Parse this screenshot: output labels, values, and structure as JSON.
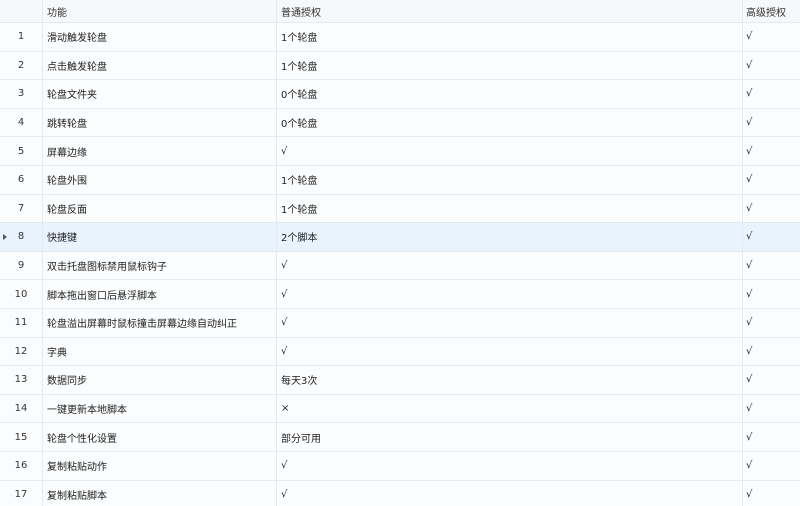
{
  "columns": [
    "功能",
    "普通授权",
    "高级授权"
  ],
  "selected_index": 7,
  "rows": [
    {
      "no": "1",
      "feature": "滑动触发轮盘",
      "normal": "1个轮盘",
      "advanced": "√"
    },
    {
      "no": "2",
      "feature": "点击触发轮盘",
      "normal": "1个轮盘",
      "advanced": "√"
    },
    {
      "no": "3",
      "feature": "轮盘文件夹",
      "normal": "0个轮盘",
      "advanced": "√"
    },
    {
      "no": "4",
      "feature": "跳转轮盘",
      "normal": "0个轮盘",
      "advanced": "√"
    },
    {
      "no": "5",
      "feature": "屏幕边缘",
      "normal": "√",
      "advanced": "√"
    },
    {
      "no": "6",
      "feature": "轮盘外围",
      "normal": "1个轮盘",
      "advanced": "√"
    },
    {
      "no": "7",
      "feature": "轮盘反面",
      "normal": "1个轮盘",
      "advanced": "√"
    },
    {
      "no": "8",
      "feature": "快捷键",
      "normal": "2个脚本",
      "advanced": "√"
    },
    {
      "no": "9",
      "feature": "双击托盘图标禁用鼠标钩子",
      "normal": "√",
      "advanced": "√"
    },
    {
      "no": "10",
      "feature": "脚本拖出窗口后悬浮脚本",
      "normal": "√",
      "advanced": "√"
    },
    {
      "no": "11",
      "feature": "轮盘溢出屏幕时鼠标撞击屏幕边缘自动纠正",
      "normal": "√",
      "advanced": "√"
    },
    {
      "no": "12",
      "feature": "字典",
      "normal": "√",
      "advanced": "√"
    },
    {
      "no": "13",
      "feature": "数据同步",
      "normal": "每天3次",
      "advanced": "√"
    },
    {
      "no": "14",
      "feature": "一键更新本地脚本",
      "normal": "×",
      "advanced": "√"
    },
    {
      "no": "15",
      "feature": "轮盘个性化设置",
      "normal": "部分可用",
      "advanced": "√"
    },
    {
      "no": "16",
      "feature": "复制粘贴动作",
      "normal": "√",
      "advanced": "√"
    },
    {
      "no": "17",
      "feature": "复制粘贴脚本",
      "normal": "√",
      "advanced": "√"
    }
  ]
}
